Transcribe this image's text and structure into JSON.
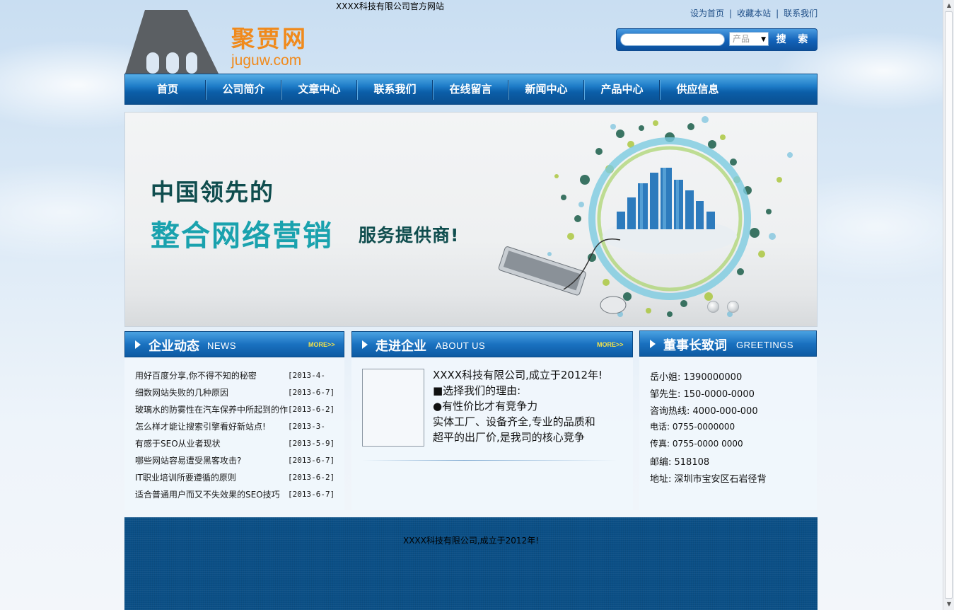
{
  "site": {
    "title": "XXXX科技有限公司官方网站"
  },
  "logo": {
    "name": "聚贾网",
    "domain": "juguw.com"
  },
  "top_links": [
    "设为首页",
    "收藏本站",
    "联系我们"
  ],
  "search": {
    "placeholder": "",
    "category": "产品",
    "button": "搜 索"
  },
  "nav": [
    "首页",
    "公司简介",
    "文章中心",
    "联系我们",
    "在线留言",
    "新闻中心",
    "产品中心",
    "供应信息"
  ],
  "banner": {
    "line1": "中国领先的",
    "line2": "整合网络营销",
    "line3": "服务提供商!"
  },
  "news": {
    "title": "企业动态",
    "subtitle": "NEWS",
    "more": "MORE>>",
    "items": [
      {
        "title": "用好百度分享,你不得不知的秘密",
        "date": "[2013-4-"
      },
      {
        "title": "细数网站失败的几种原因",
        "date": "[2013-6-7]"
      },
      {
        "title": "玻璃水的防雾性在汽车保养中所起到的作用",
        "date": "[2013-6-2]"
      },
      {
        "title": "怎么样才能让搜索引擎看好新站点!",
        "date": "[2013-3-"
      },
      {
        "title": "有感于SEO从业者现状",
        "date": "[2013-5-9]"
      },
      {
        "title": "哪些网站容易遭受黑客攻击?",
        "date": "[2013-6-7]"
      },
      {
        "title": "IT职业培训所要遵循的原则",
        "date": "[2013-6-2]"
      },
      {
        "title": "适合普通用户而又不失效果的SEO技巧",
        "date": "[2013-6-7]"
      }
    ]
  },
  "about": {
    "title": "走进企业",
    "subtitle": "ABOUT US",
    "more": "MORE>>",
    "lines": [
      "XXXX科技有限公司,成立于2012年!",
      "■选择我们的理由:",
      "●有性价比才有竞争力",
      "实体工厂、设备齐全,专业的品质和",
      "超平的出厂价,是我司的核心竞争"
    ]
  },
  "greetings": {
    "title": "董事长致词",
    "subtitle": "GREETINGS",
    "contacts": [
      "岳小姐: 1390000000",
      "邹先生: 150-0000-0000",
      "咨询热线:  4000-000-000",
      "电话: 0755-0000000",
      "传真: 0755-0000 0000",
      "邮编: 518108",
      "地址: 深圳市宝安区石岩径背"
    ]
  },
  "footer": {
    "text": "XXXX科技有限公司,成立于2012年!"
  },
  "colors": {
    "nav": "#0b5ea8",
    "logo_orange": "#f08a1c",
    "footer": "#0b4f86",
    "banner_teal": "#1aa2ae"
  }
}
